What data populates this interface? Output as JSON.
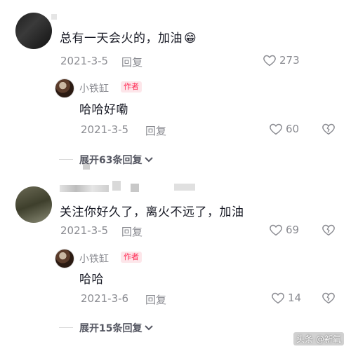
{
  "comments": [
    {
      "text": "总有一天会火的，加油",
      "emoji": "😁",
      "date": "2021-3-5",
      "reply_label": "回复",
      "likes": "273"
    },
    {
      "text": "关注你好久了，离火不远了，加油",
      "date": "2021-3-5",
      "reply_label": "回复",
      "likes": "69"
    }
  ],
  "replies": [
    {
      "author": "小铁缸",
      "badge": "作者",
      "text": "哈哈好嘞",
      "date": "2021-3-5",
      "reply_label": "回复",
      "likes": "60"
    },
    {
      "author": "小铁缸",
      "badge": "作者",
      "text": "哈哈",
      "date": "2021-3-6",
      "reply_label": "回复",
      "likes": "14"
    }
  ],
  "expand": [
    "展开63条回复",
    "展开15条回复"
  ],
  "watermark": "头条 @新氧",
  "icons": [
    "heart-outline-icon",
    "broken-heart-icon",
    "chevron-down-icon"
  ]
}
